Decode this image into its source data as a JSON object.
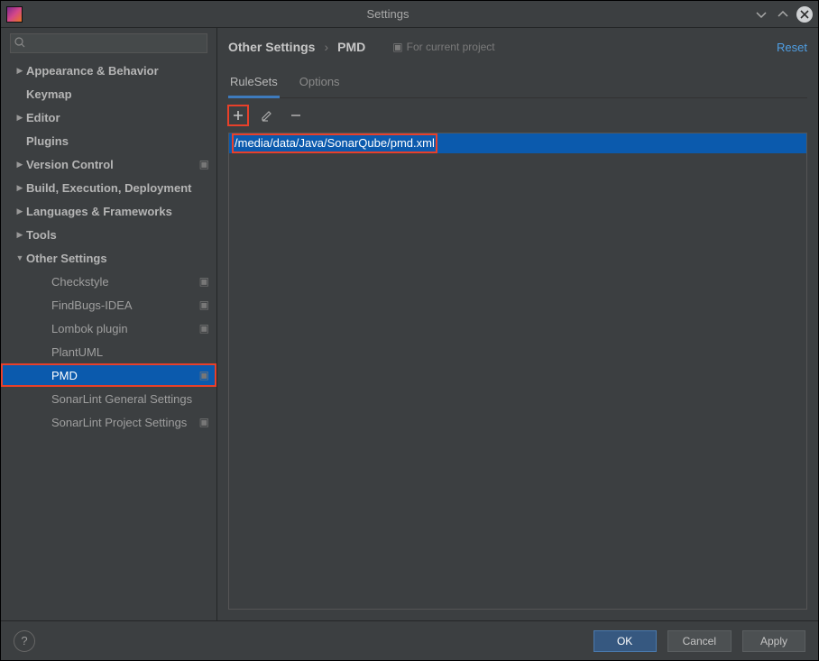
{
  "window": {
    "title": "Settings"
  },
  "sidebar": {
    "search_placeholder": "",
    "items": [
      {
        "label": "Appearance & Behavior",
        "expandable": true
      },
      {
        "label": "Keymap",
        "expandable": false
      },
      {
        "label": "Editor",
        "expandable": true
      },
      {
        "label": "Plugins",
        "expandable": false
      },
      {
        "label": "Version Control",
        "expandable": true,
        "badge": true
      },
      {
        "label": "Build, Execution, Deployment",
        "expandable": true
      },
      {
        "label": "Languages & Frameworks",
        "expandable": true
      },
      {
        "label": "Tools",
        "expandable": true
      },
      {
        "label": "Other Settings",
        "expandable": true,
        "expanded": true,
        "children": [
          {
            "label": "Checkstyle",
            "badge": true
          },
          {
            "label": "FindBugs-IDEA",
            "badge": true
          },
          {
            "label": "Lombok plugin",
            "badge": true
          },
          {
            "label": "PlantUML"
          },
          {
            "label": "PMD",
            "badge": true,
            "selected": true,
            "highlighted": true
          },
          {
            "label": "SonarLint General Settings"
          },
          {
            "label": "SonarLint Project Settings",
            "badge": true
          }
        ]
      }
    ]
  },
  "breadcrumb": {
    "root": "Other Settings",
    "current": "PMD"
  },
  "project_note": "For current project",
  "reset": "Reset",
  "tabs": [
    {
      "label": "RuleSets",
      "active": true
    },
    {
      "label": "Options"
    }
  ],
  "rulesets": {
    "items": [
      {
        "path": "/media/data/Java/SonarQube/pmd.xml",
        "selected": true,
        "highlighted": true
      }
    ]
  },
  "buttons": {
    "ok": "OK",
    "cancel": "Cancel",
    "apply": "Apply"
  }
}
